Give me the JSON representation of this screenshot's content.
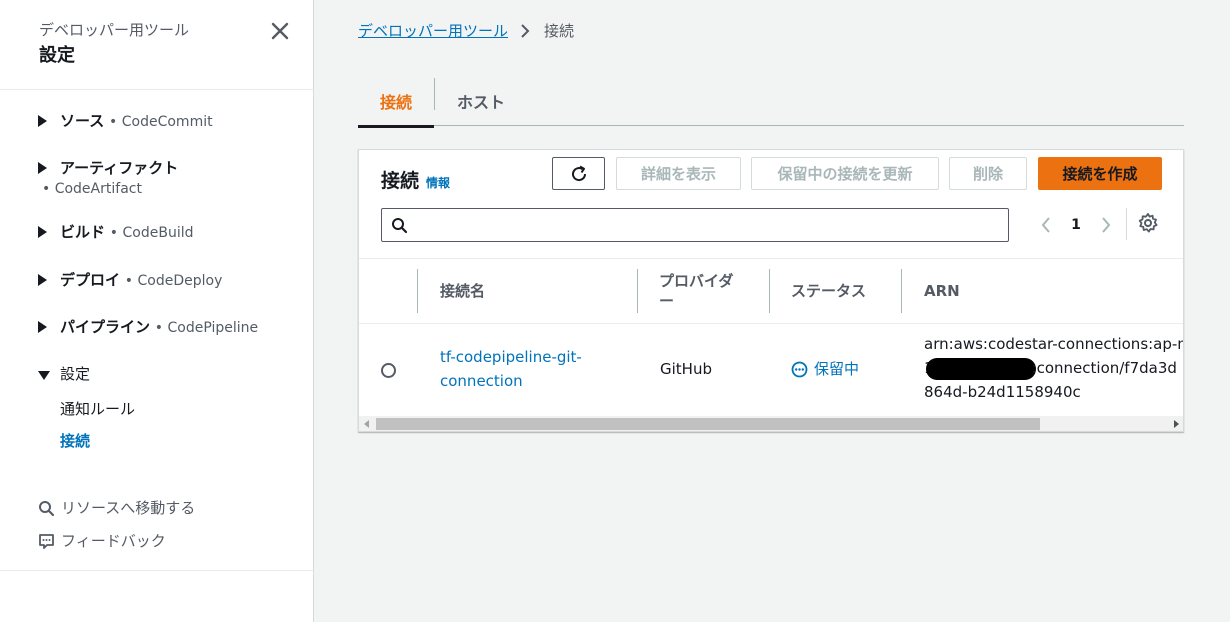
{
  "sidebar": {
    "subtitle": "デベロッパー用ツール",
    "title": "設定",
    "sections": [
      {
        "label": "ソース",
        "service": "• CodeCommit"
      },
      {
        "label": "アーティファクト",
        "service": "• CodeArtifact"
      },
      {
        "label": "ビルド",
        "service": "• CodeBuild"
      },
      {
        "label": "デプロイ",
        "service": "• CodeDeploy"
      },
      {
        "label": "パイプライン",
        "service": "• CodePipeline"
      },
      {
        "label": "設定"
      }
    ],
    "sub_items": [
      "通知ルール",
      "接続"
    ],
    "links": [
      "リソースへ移動する",
      "フィードバック"
    ]
  },
  "breadcrumb": {
    "root": "デベロッパー用ツール",
    "current": "接続"
  },
  "tabs": [
    "接続",
    "ホスト"
  ],
  "panel": {
    "title": "接続",
    "info": "情報",
    "buttons": {
      "view_details": "詳細を表示",
      "update_pending": "保留中の接続を更新",
      "delete": "削除",
      "create": "接続を作成"
    },
    "search": {
      "placeholder": "",
      "value": ""
    },
    "page": "1"
  },
  "table": {
    "columns": [
      "接続名",
      "プロバイダー",
      "ステータス",
      "ARN"
    ],
    "rows": [
      {
        "name_line1": "tf-codepipeline-git-",
        "name_line2": "connection",
        "provider": "GitHub",
        "status": "保留中",
        "arn_line1": "arn:aws:codestar-connections:ap-nort",
        "arn_line2_prefix": "1",
        "arn_line2_suffix": ":connection/f7da3d",
        "arn_line3": "864d-b24d1158940c"
      }
    ]
  },
  "colors": {
    "accent_orange": "#ec7211",
    "link_blue": "#0073bb",
    "text_dark": "#16191f",
    "text_gray": "#545b64",
    "background": "#f2f3f3"
  }
}
